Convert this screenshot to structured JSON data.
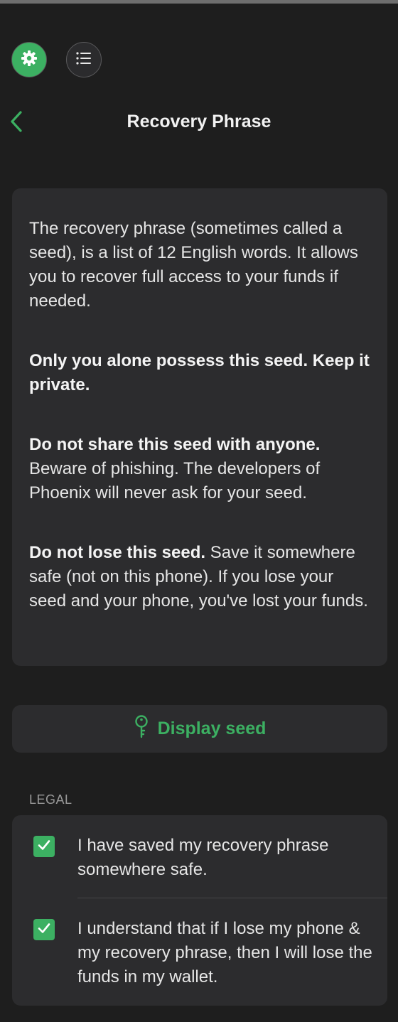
{
  "header": {
    "title": "Recovery Phrase",
    "settings_icon": "gear-icon",
    "menu_icon": "list-icon",
    "back_icon": "chevron-left-icon"
  },
  "info": {
    "paragraph1": "The recovery phrase (sometimes called a seed), is a list of 12 English words. It allows you to recover full access to your funds if needed.",
    "paragraph2_bold": "Only you alone possess this seed. Keep it private.",
    "paragraph3_bold": "Do not share this seed with anyone.",
    "paragraph3_rest": " Beware of phishing. The developers of Phoenix will never ask for your seed.",
    "paragraph4_bold": "Do not lose this seed.",
    "paragraph4_rest": " Save it somewhere safe (not on this phone). If you lose your seed and your phone, you've lost your funds."
  },
  "display_seed": {
    "label": "Display seed",
    "icon": "key-icon"
  },
  "legal": {
    "header": "LEGAL",
    "items": [
      {
        "checked": true,
        "text": "I have saved my recovery phrase somewhere safe."
      },
      {
        "checked": true,
        "text": "I understand that if I lose my phone & my recovery phrase, then I will lose the funds in my wallet."
      }
    ]
  },
  "colors": {
    "accent": "#3cb062",
    "background": "#1e1e1e",
    "card": "#2c2c2e"
  }
}
